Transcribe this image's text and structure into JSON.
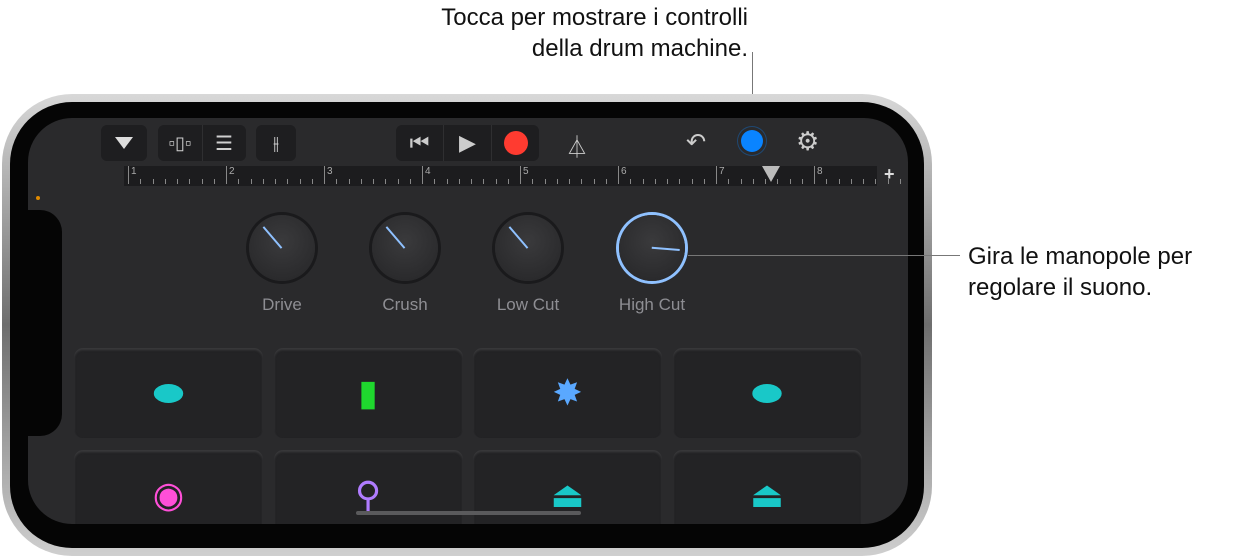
{
  "callouts": {
    "top": [
      "Tocca per mostrare i controlli",
      "della drum machine."
    ],
    "right": [
      "Gira le manopole per",
      "regolare il suono."
    ]
  },
  "ruler": {
    "bars": [
      "1",
      "2",
      "3",
      "4",
      "5",
      "6",
      "7",
      "8"
    ],
    "add_label": "+"
  },
  "knobs": [
    {
      "label": "Drive",
      "value": 0.35,
      "active": false
    },
    {
      "label": "Crush",
      "value": 0.35,
      "active": false
    },
    {
      "label": "Low Cut",
      "value": 0.35,
      "active": false
    },
    {
      "label": "High Cut",
      "value": 0.85,
      "active": true
    }
  ],
  "pads": [
    {
      "icon": "crash-cymbal-icon",
      "color": "#19c8c8"
    },
    {
      "icon": "snare-drum-icon",
      "color": "#1fd82e"
    },
    {
      "icon": "clap-burst-icon",
      "color": "#5aa8ff"
    },
    {
      "icon": "ride-cymbal-icon",
      "color": "#19c8c8"
    },
    {
      "icon": "kick-drum-icon",
      "color": "#ff4fd8"
    },
    {
      "icon": "maraca-icon",
      "color": "#b07cff"
    },
    {
      "icon": "hihat-closed-icon",
      "color": "#19c8c8"
    },
    {
      "icon": "hihat-open-icon",
      "color": "#19c8c8"
    }
  ],
  "colors": {
    "record": "#ff3b30",
    "accent": "#0a84ff",
    "knob_active": "#8fc1ff"
  }
}
